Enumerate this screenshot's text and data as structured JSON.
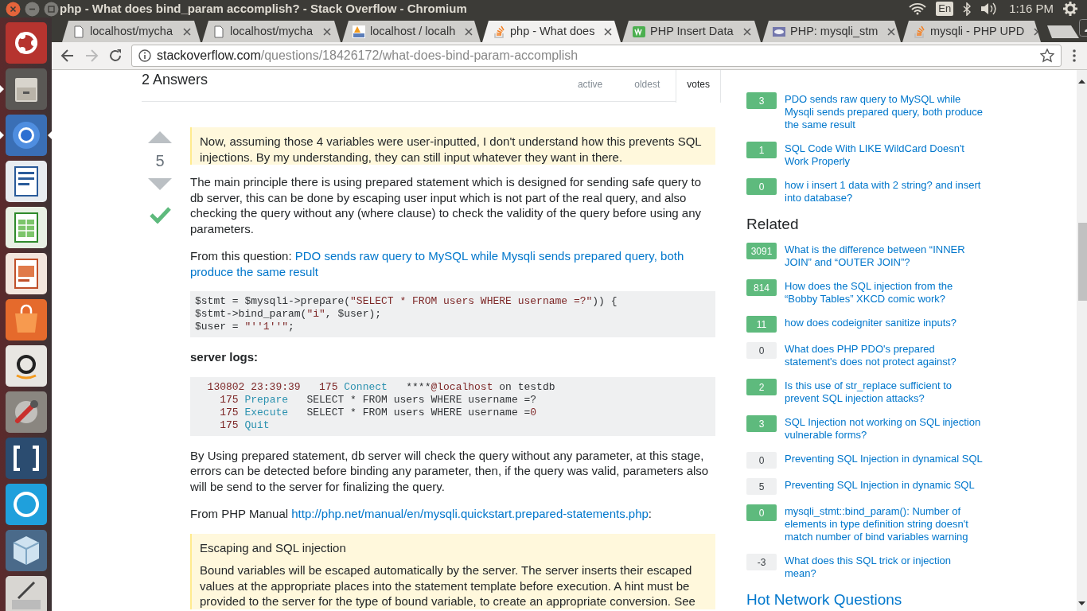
{
  "os_bar": {
    "title": "php - What does bind_param accomplish? - Stack Overflow - Chromium",
    "keyboard": "En",
    "clock": "1:16 PM"
  },
  "launcher": [
    {
      "kind": "home",
      "running": false,
      "focused": false
    },
    {
      "kind": "files",
      "running": true,
      "focused": false
    },
    {
      "kind": "browser",
      "running": true,
      "focused": true
    },
    {
      "kind": "writer",
      "running": false,
      "focused": false
    },
    {
      "kind": "calc",
      "running": false,
      "focused": false
    },
    {
      "kind": "impress",
      "running": false,
      "focused": false
    },
    {
      "kind": "store",
      "running": false,
      "focused": false
    },
    {
      "kind": "shop",
      "running": false,
      "focused": false
    },
    {
      "kind": "settings",
      "running": false,
      "focused": false
    },
    {
      "kind": "editor",
      "running": false,
      "focused": false
    },
    {
      "kind": "chat",
      "running": false,
      "focused": false
    },
    {
      "kind": "cube",
      "running": false,
      "focused": false
    },
    {
      "kind": "draw",
      "running": false,
      "focused": false
    }
  ],
  "tabs": [
    {
      "title": "localhost/mycha",
      "kind": "page",
      "selected": false
    },
    {
      "title": "localhost/mycha",
      "kind": "page",
      "selected": false
    },
    {
      "title": "localhost / localh",
      "kind": "pma",
      "selected": false
    },
    {
      "title": "php - What does",
      "kind": "so",
      "selected": true
    },
    {
      "title": "PHP Insert Data",
      "kind": "w3",
      "selected": false
    },
    {
      "title": "PHP: mysqli_stm",
      "kind": "php",
      "selected": false
    },
    {
      "title": "mysqli - PHP UPD",
      "kind": "so",
      "selected": false
    }
  ],
  "address_bar": {
    "host": "stackoverflow.com",
    "path": "/questions/18426172/what-does-bind-param-accomplish"
  },
  "answers": {
    "heading": "2 Answers",
    "sort_tabs": [
      {
        "label": "active",
        "selected": false
      },
      {
        "label": "oldest",
        "selected": false
      },
      {
        "label": "votes",
        "selected": true
      }
    ]
  },
  "answer": {
    "score": "5",
    "accepted": true,
    "blocks": [
      {
        "kind": "quote",
        "paragraphs": [
          "Now, assuming those 4 variables were user-inputted, I don't understand how this prevents SQL injections. By my understanding, they can still input whatever they want in there."
        ]
      },
      {
        "kind": "paragraph",
        "parts": [
          {
            "kind": "text",
            "text": "The main principle there is using prepared statement which is designed for sending safe query to db server, this can be done by escaping user input which is not part of the real query, and also checking the query without any (where clause) to check the validity of the query before using any parameters."
          }
        ]
      },
      {
        "kind": "paragraph",
        "parts": [
          {
            "kind": "text",
            "text": "From this question: "
          },
          {
            "kind": "link",
            "text": "PDO sends raw query to MySQL while Mysqli sends prepared query, both produce the same result"
          }
        ]
      },
      {
        "kind": "code",
        "lines": [
          [
            {
              "kind": "plain",
              "text": "$stmt = $mysqli->prepare("
            },
            {
              "kind": "string",
              "text": "\"SELECT * FROM users WHERE username =?\""
            },
            {
              "kind": "plain",
              "text": ")) {"
            }
          ],
          [
            {
              "kind": "plain",
              "text": "$stmt->bind_param("
            },
            {
              "kind": "string",
              "text": "\"i\""
            },
            {
              "kind": "plain",
              "text": ", $user);"
            }
          ],
          [
            {
              "kind": "plain",
              "text": "$user = "
            },
            {
              "kind": "string",
              "text": "\"''1''\""
            },
            {
              "kind": "plain",
              "text": ";"
            }
          ]
        ]
      },
      {
        "kind": "heading",
        "text": "server logs:"
      },
      {
        "kind": "code",
        "lines": [
          [
            {
              "kind": "number",
              "text": "  130802 23:39:39   175 "
            },
            {
              "kind": "keyword",
              "text": "Connect"
            },
            {
              "kind": "plain",
              "text": "   ****"
            },
            {
              "kind": "string",
              "text": "@localhost"
            },
            {
              "kind": "plain",
              "text": " on testdb"
            }
          ],
          [
            {
              "kind": "number",
              "text": "    175 "
            },
            {
              "kind": "keyword",
              "text": "Prepare"
            },
            {
              "kind": "plain",
              "text": "   SELECT * FROM users WHERE username =?"
            }
          ],
          [
            {
              "kind": "number",
              "text": "    175 "
            },
            {
              "kind": "keyword",
              "text": "Execute"
            },
            {
              "kind": "plain",
              "text": "   SELECT * FROM users WHERE username ="
            },
            {
              "kind": "number",
              "text": "0"
            }
          ],
          [
            {
              "kind": "number",
              "text": "    175 "
            },
            {
              "kind": "keyword",
              "text": "Quit"
            }
          ]
        ]
      },
      {
        "kind": "paragraph",
        "parts": [
          {
            "kind": "text",
            "text": "By Using prepared statement, db server will check the query without any parameter, at this stage, errors can be detected before binding any parameter, then, if the query was valid, parameters also will be send to the server for finalizing the query."
          }
        ]
      },
      {
        "kind": "paragraph",
        "parts": [
          {
            "kind": "text",
            "text": "From PHP Manual "
          },
          {
            "kind": "link",
            "text": "http://php.net/manual/en/mysqli.quickstart.prepared-statements.php"
          },
          {
            "kind": "text",
            "text": ":"
          }
        ]
      },
      {
        "kind": "quote",
        "paragraphs": [
          "Escaping and SQL injection",
          "Bound variables will be escaped automatically by the server. The server inserts their escaped values at the appropriate places into the statement template before execution. A hint must be provided to the server for the type of bound variable, to create an appropriate conversion. See"
        ]
      }
    ]
  },
  "linked": [
    {
      "score": "3",
      "answered": true,
      "title": "PDO sends raw query to MySQL while Mysqli sends prepared query, both produce the same result"
    },
    {
      "score": "1",
      "answered": true,
      "title": "SQL Code With LIKE WildCard Doesn't Work Properly"
    },
    {
      "score": "0",
      "answered": true,
      "title": "how i insert 1 data with 2 string? and insert into database?"
    }
  ],
  "related": {
    "heading": "Related",
    "items": [
      {
        "score": "3091",
        "answered": true,
        "title": "What is the difference between “INNER JOIN” and “OUTER JOIN”?"
      },
      {
        "score": "814",
        "answered": true,
        "title": "How does the SQL injection from the “Bobby Tables” XKCD comic work?"
      },
      {
        "score": "11",
        "answered": true,
        "title": "how does codeigniter sanitize inputs?"
      },
      {
        "score": "0",
        "answered": false,
        "title": "What does PHP PDO's prepared statement's does not protect against?"
      },
      {
        "score": "2",
        "answered": true,
        "title": "Is this use of str_replace sufficient to prevent SQL injection attacks?"
      },
      {
        "score": "3",
        "answered": true,
        "title": "SQL Injection not working on SQL injection vulnerable forms?"
      },
      {
        "score": "0",
        "answered": false,
        "title": "Preventing SQL Injection in dynamical SQL"
      },
      {
        "score": "5",
        "answered": false,
        "title": "Preventing SQL Injection in dynamic SQL"
      },
      {
        "score": "0",
        "answered": true,
        "title": "mysqli_stmt::bind_param(): Number of elements in type definition string doesn't match number of bind variables warning"
      },
      {
        "score": "-3",
        "answered": false,
        "title": "What does this SQL trick or injection mean?"
      }
    ]
  },
  "hot_network": {
    "heading": "Hot Network Questions"
  }
}
